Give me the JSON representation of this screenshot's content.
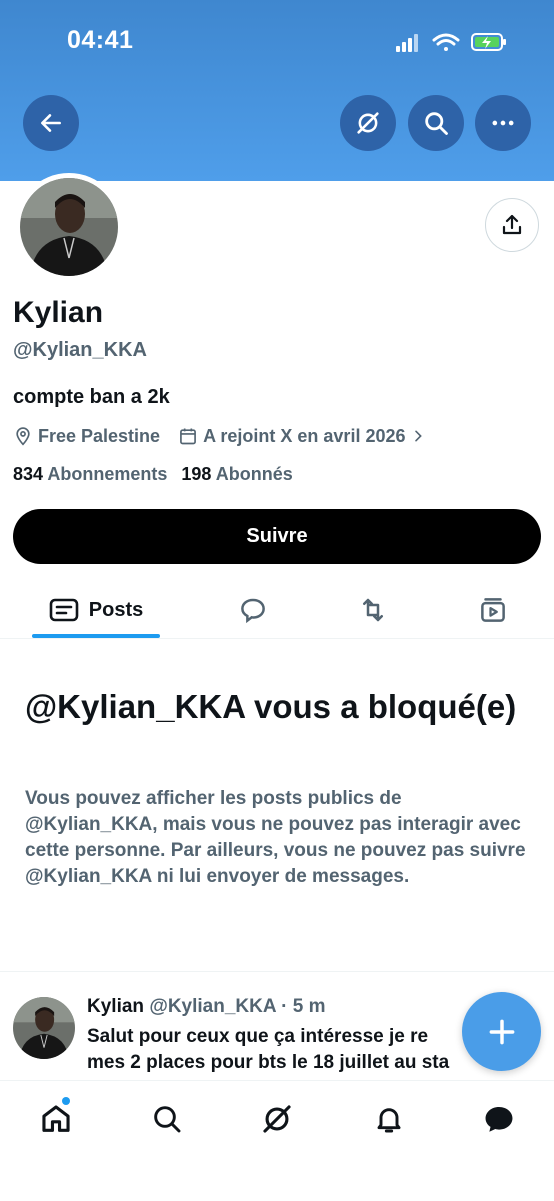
{
  "status_bar": {
    "time": "04:41"
  },
  "header": {
    "back_icon": "arrow-left-icon",
    "grok_icon": "grok-icon",
    "search_icon": "search-icon",
    "more_icon": "ellipsis-icon"
  },
  "profile": {
    "name": "Kylian",
    "handle": "@Kylian_KKA",
    "bio": "compte ban a 2k",
    "location": "Free Palestine",
    "joined": "A rejoint X en avril 2026",
    "following_count": "834",
    "following_label": "Abonnements",
    "followers_count": "198",
    "followers_label": "Abonnés",
    "follow_button": "Suivre"
  },
  "tabs": {
    "posts_label": "Posts"
  },
  "blocked": {
    "title": "@Kylian_KKA vous a bloqué(e)",
    "message": "Vous pouvez afficher les posts publics de @Kylian_KKA, mais vous ne pouvez pas interagir avec cette personne. Par ailleurs, vous ne pouvez pas suivre @Kylian_KKA ni lui envoyer de messages."
  },
  "post": {
    "name": "Kylian",
    "handle_time": "@Kylian_KKA · 5 m",
    "line1": "Salut pour ceux que ça intéresse je re",
    "line2": "mes 2 places pour bts le 18 juillet au sta"
  },
  "colors": {
    "banner": "#4a97e3",
    "accent": "#1d9bf0",
    "secondary_text": "#536471"
  }
}
